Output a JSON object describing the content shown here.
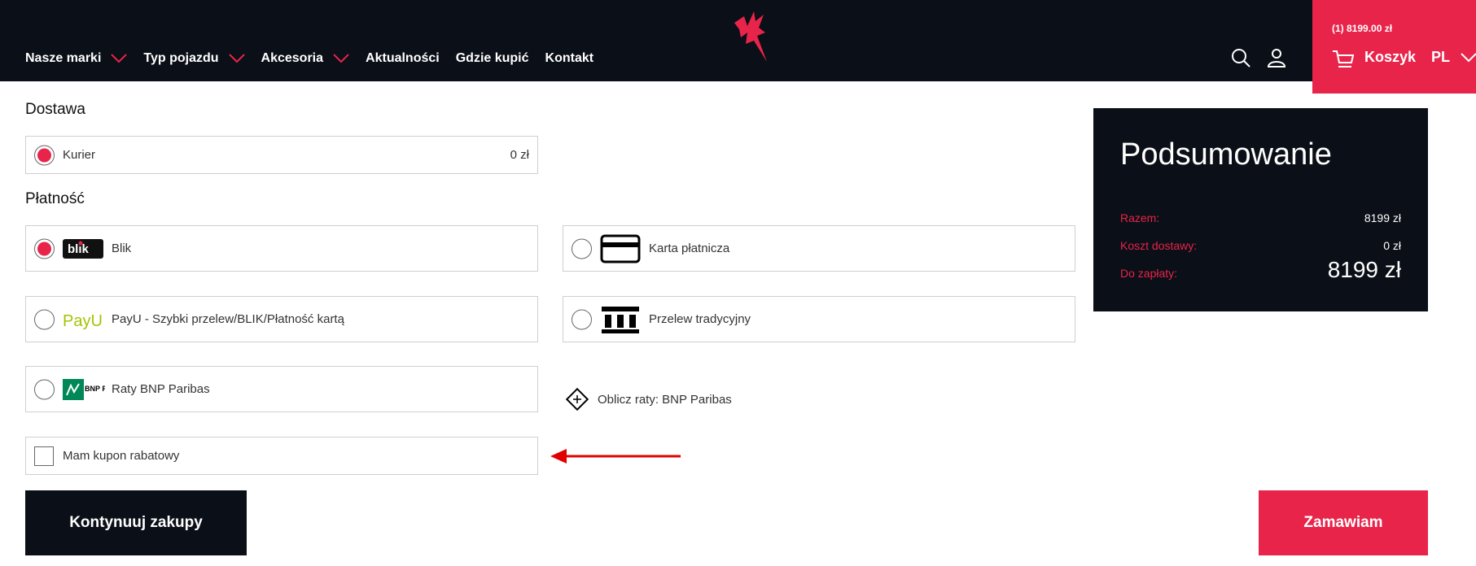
{
  "header": {
    "nav": [
      {
        "label": "Nasze marki",
        "dropdown": true
      },
      {
        "label": "Typ pojazdu",
        "dropdown": true
      },
      {
        "label": "Akcesoria",
        "dropdown": true
      },
      {
        "label": "Aktualności",
        "dropdown": false
      },
      {
        "label": "Gdzie kupić",
        "dropdown": false
      },
      {
        "label": "Kontakt",
        "dropdown": false
      }
    ],
    "logo_icon": "pegasus-logo-icon",
    "search_icon": "search-icon",
    "account_icon": "user-icon",
    "cart": {
      "amount": "(1) 8199.00 zł",
      "label": "Koszyk",
      "icon": "cart-icon"
    },
    "language": "PL"
  },
  "delivery": {
    "title": "Dostawa",
    "options": [
      {
        "label": "Kurier",
        "price": "0 zł",
        "selected": true
      }
    ]
  },
  "payment": {
    "title": "Płatność",
    "options": [
      {
        "label": "Blik",
        "logo": "blik-logo",
        "logo_text": "blik",
        "selected": true
      },
      {
        "label": "Karta płatnicza",
        "logo": "credit-card-icon",
        "selected": false
      },
      {
        "label": "PayU - Szybki przelew/BLIK/Płatność kartą",
        "logo": "payu-logo",
        "logo_text": "PayU",
        "selected": false
      },
      {
        "label": "Przelew tradycyjny",
        "logo": "bank-icon",
        "selected": false
      },
      {
        "label": "Raty BNP Paribas",
        "logo": "bnp-paribas-logo",
        "logo_text": "BNP PARIBAS",
        "selected": false
      }
    ],
    "calculator": "Oblicz raty: BNP Paribas"
  },
  "coupon": {
    "label": "Mam kupon rabatowy",
    "checked": false
  },
  "summary": {
    "title": "Podsumowanie",
    "rows": [
      {
        "key": "Razem:",
        "value": "8199 zł"
      },
      {
        "key": "Koszt dostawy:",
        "value": "0 zł"
      },
      {
        "key": "Do zapłaty:",
        "value": "8199 zł"
      }
    ]
  },
  "buttons": {
    "continue": "Kontynuuj zakupy",
    "order": "Zamawiam"
  },
  "colors": {
    "accent": "#e8244a",
    "dark": "#0b0f17",
    "arrow": "#e00000"
  }
}
